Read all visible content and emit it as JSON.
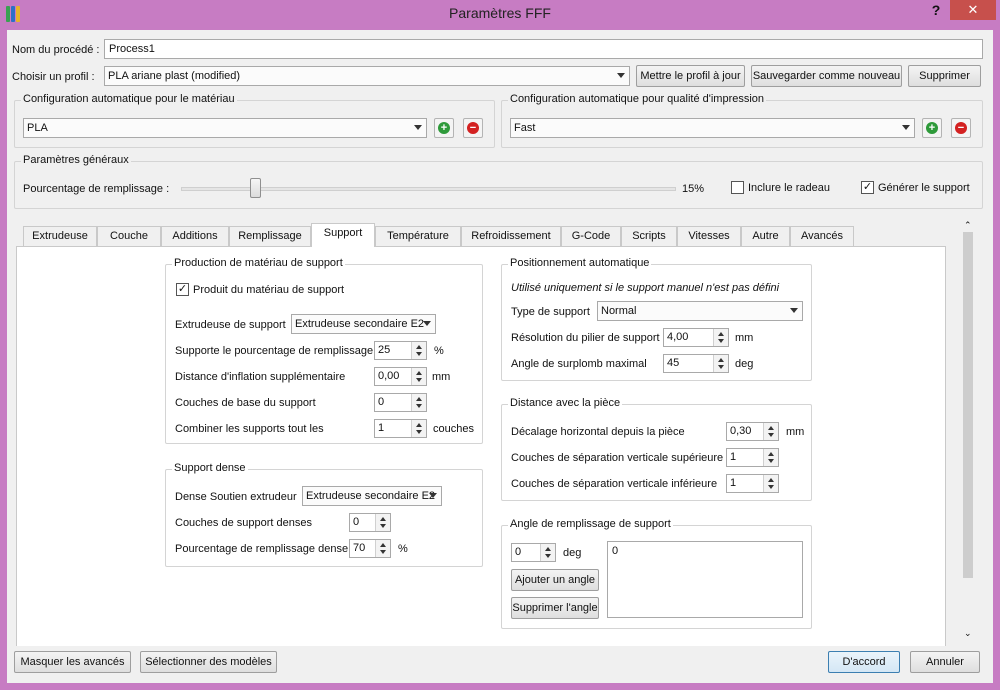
{
  "window": {
    "title": "Paramètres FFF",
    "help_symbol": "?",
    "close_symbol": "✕"
  },
  "process": {
    "name_label": "Nom du procédé :",
    "name_value": "Process1"
  },
  "profile": {
    "label": "Choisir un profil :",
    "selected": "PLA ariane plast (modified)",
    "update_button": "Mettre le profil à jour",
    "save_new_button": "Sauvegarder comme nouveau",
    "delete_button": "Supprimer"
  },
  "auto_material": {
    "title": "Configuration automatique pour le matériau",
    "selected": "PLA"
  },
  "auto_quality": {
    "title": "Configuration automatique pour qualité d'impression",
    "selected": "Fast"
  },
  "general": {
    "title": "Paramètres généraux",
    "infill_label": "Pourcentage de remplissage :",
    "infill_value_text": "15%",
    "infill_fraction": 0.15,
    "raft_label": "Inclure le radeau",
    "raft_checked": false,
    "support_label": "Générer le support",
    "support_checked": true,
    "check_mark": "✓"
  },
  "tabs": [
    {
      "label": "Extrudeuse"
    },
    {
      "label": "Couche"
    },
    {
      "label": "Additions"
    },
    {
      "label": "Remplissage"
    },
    {
      "label": "Support"
    },
    {
      "label": "Température"
    },
    {
      "label": "Refroidissement"
    },
    {
      "label": "G-Code"
    },
    {
      "label": "Scripts"
    },
    {
      "label": "Vitesses"
    },
    {
      "label": "Autre"
    },
    {
      "label": "Avancés"
    }
  ],
  "support_material": {
    "title": "Production de matériau de support",
    "generate_label": "Produit du matériau de support",
    "generate_checked": true,
    "extruder_label": "Extrudeuse de support",
    "extruder_value": "Extrudeuse secondaire E2",
    "infill_label": "Supporte le pourcentage de remplissage",
    "infill_value": "25",
    "infill_unit": "%",
    "inflation_label": "Distance d'inflation supplémentaire",
    "inflation_value": "0,00",
    "inflation_unit": "mm",
    "base_layers_label": "Couches de base du support",
    "base_layers_value": "0",
    "combine_label": "Combiner les supports tout les",
    "combine_value": "1",
    "combine_unit": "couches"
  },
  "dense_support": {
    "title": "Support dense",
    "extruder_label": "Dense Soutien extrudeur",
    "extruder_value": "Extrudeuse secondaire E2",
    "layers_label": "Couches de support denses",
    "layers_value": "0",
    "infill_label": "Pourcentage de remplissage dense",
    "infill_value": "70",
    "infill_unit": "%"
  },
  "auto_position": {
    "title": "Positionnement automatique",
    "note": "Utilisé uniquement si le support manuel n'est pas défini",
    "type_label": "Type de support",
    "type_value": "Normal",
    "pillar_label": "Résolution du pilier de support",
    "pillar_value": "4,00",
    "pillar_unit": "mm",
    "overhang_label": "Angle de surplomb maximal",
    "overhang_value": "45",
    "overhang_unit": "deg"
  },
  "part_distance": {
    "title": "Distance avec la pièce",
    "horizontal_label": "Décalage horizontal depuis la pièce",
    "horizontal_value": "0,30",
    "horizontal_unit": "mm",
    "top_label": "Couches de séparation verticale supérieure",
    "top_value": "1",
    "bottom_label": "Couches de séparation verticale inférieure",
    "bottom_value": "1"
  },
  "infill_angle": {
    "title": "Angle de remplissage de support",
    "angle_value": "0",
    "angle_unit": "deg",
    "add_button": "Ajouter un angle",
    "remove_button": "Supprimer l'angle",
    "list_value": "0"
  },
  "footer": {
    "hide_advanced_button": "Masquer les avancés",
    "select_models_button": "Sélectionner des modèles",
    "ok_button": "D'accord",
    "cancel_button": "Annuler"
  },
  "colors": {
    "titlebar": "#c77cc3",
    "close": "#c7504c",
    "plus": "#2e9a3a",
    "minus": "#d32121"
  }
}
